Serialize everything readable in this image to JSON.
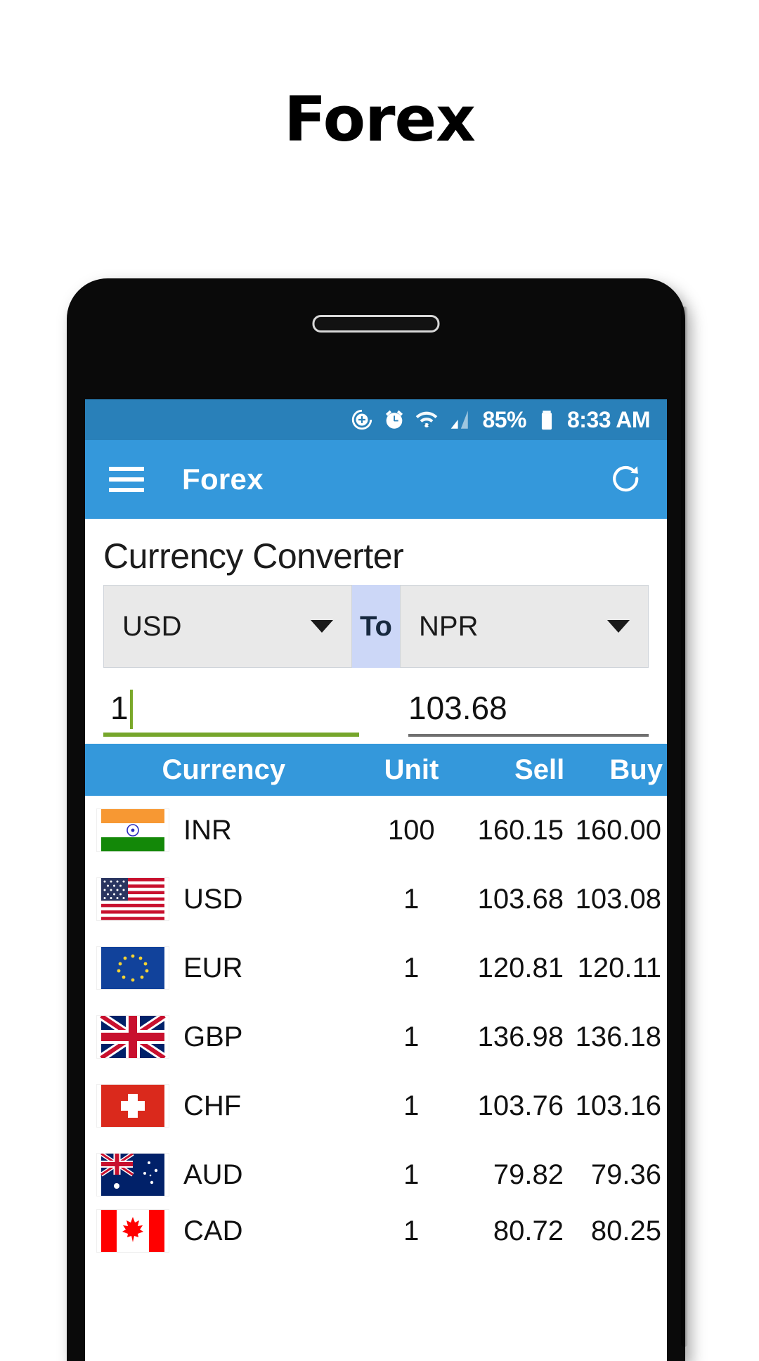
{
  "hero": {
    "title": "Forex"
  },
  "status_bar": {
    "battery_percent": "85%",
    "time": "8:33 AM",
    "icons": [
      "add-contact-icon",
      "alarm-icon",
      "wifi-icon",
      "signal-icon",
      "battery-icon"
    ]
  },
  "app_bar": {
    "title": "Forex",
    "menu_icon": "hamburger-menu-icon",
    "refresh_icon": "refresh-icon"
  },
  "converter": {
    "heading": "Currency Converter",
    "from_currency": "USD",
    "to_label": "To",
    "to_currency": "NPR",
    "from_amount": "1",
    "to_amount": "103.68"
  },
  "table": {
    "headers": {
      "currency": "Currency",
      "unit": "Unit",
      "sell": "Sell",
      "buy": "Buy"
    },
    "rows": [
      {
        "flag": "india-flag",
        "code": "INR",
        "unit": "100",
        "sell": "160.15",
        "buy": "160.00"
      },
      {
        "flag": "usa-flag",
        "code": "USD",
        "unit": "1",
        "sell": "103.68",
        "buy": "103.08"
      },
      {
        "flag": "eu-flag",
        "code": "EUR",
        "unit": "1",
        "sell": "120.81",
        "buy": "120.11"
      },
      {
        "flag": "uk-flag",
        "code": "GBP",
        "unit": "1",
        "sell": "136.98",
        "buy": "136.18"
      },
      {
        "flag": "swiss-flag",
        "code": "CHF",
        "unit": "1",
        "sell": "103.76",
        "buy": "103.16"
      },
      {
        "flag": "australia-flag",
        "code": "AUD",
        "unit": "1",
        "sell": "79.82",
        "buy": "79.36"
      },
      {
        "flag": "canada-flag",
        "code": "CAD",
        "unit": "1",
        "sell": "80.72",
        "buy": "80.25"
      }
    ]
  },
  "colors": {
    "accent": "#3498db",
    "status_bar": "#2980b9",
    "to_box": "#ccd7f7",
    "focus_underline": "#76a62b",
    "spinner_bg": "#e9e9e9"
  }
}
